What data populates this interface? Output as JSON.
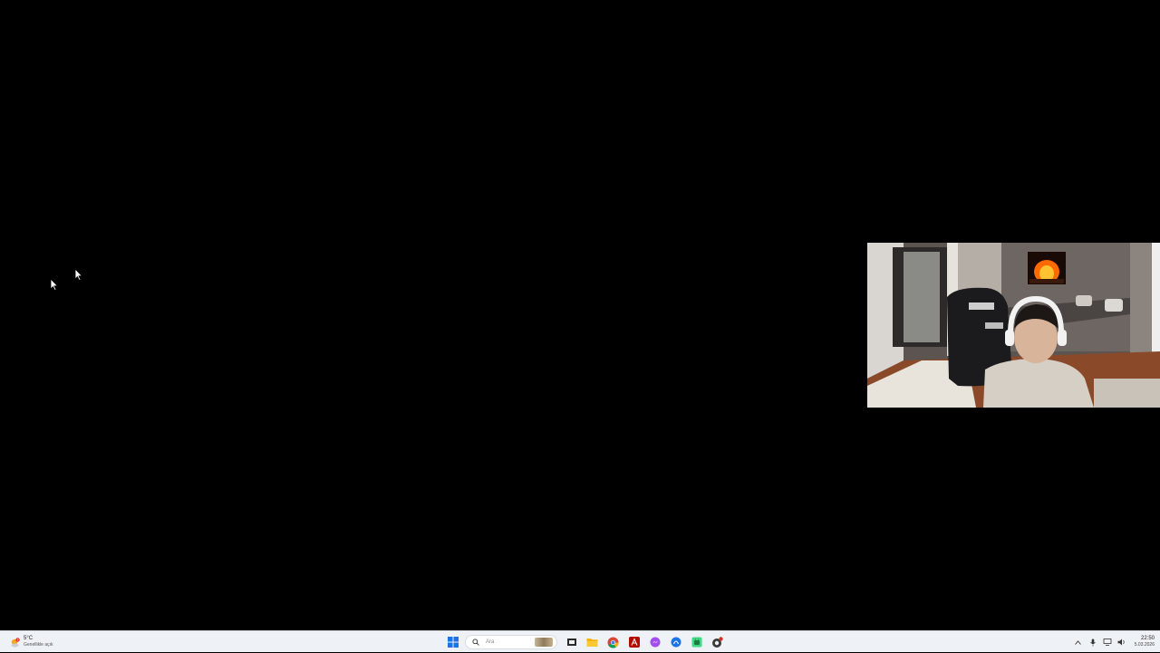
{
  "taskbar": {
    "weather": {
      "temperature": "5°C",
      "description": "Genellikle açık",
      "icon": "weather-partly-cloudy-icon",
      "badge_count": "3"
    },
    "start_icon": "windows-start-icon",
    "search": {
      "placeholder": "Ara",
      "icon": "search-icon"
    },
    "apps": [
      {
        "name": "task-view-icon"
      },
      {
        "name": "file-explorer-icon"
      },
      {
        "name": "chrome-icon"
      },
      {
        "name": "acrobat-icon"
      },
      {
        "name": "messenger-icon"
      },
      {
        "name": "copilot-icon"
      },
      {
        "name": "android-app-icon"
      },
      {
        "name": "app-with-badge-icon"
      }
    ],
    "tray": {
      "icons": [
        "chevron-up-icon",
        "microphone-icon",
        "network-icon",
        "volume-icon"
      ],
      "time": "22:50",
      "date": "5.03.2026"
    }
  },
  "colors": {
    "desktop_background": "#000000",
    "taskbar_background": "#eef1f5",
    "windows_blue": "#1a73e8",
    "fireplace_orange": "#ff6a00"
  }
}
